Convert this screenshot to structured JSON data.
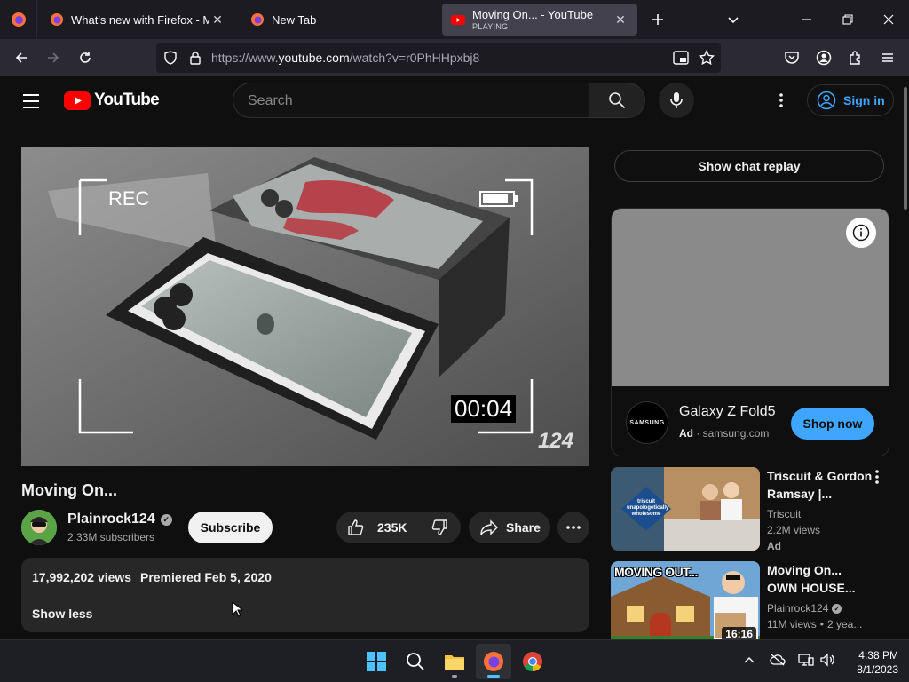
{
  "browser": {
    "tabs": [
      {
        "title": "What's new with Firefox - More",
        "subtitle": "",
        "active": false
      },
      {
        "title": "New Tab",
        "subtitle": "",
        "active": false
      },
      {
        "title": "Moving On... - YouTube",
        "subtitle": "PLAYING",
        "active": true
      }
    ],
    "url_prefix": "https://www.",
    "url_domain": "youtube.com",
    "url_path": "/watch?v=r0PhHHpxbj8"
  },
  "youtube": {
    "logo_text": "YouTube",
    "search_placeholder": "Search",
    "sign_in_label": "Sign in"
  },
  "video": {
    "overlay_rec": "REC",
    "overlay_timecode": "00:04",
    "overlay_watermark": "124",
    "title": "Moving On...",
    "channel": "Plainrock124",
    "subscribers": "2.33M subscribers",
    "subscribe_label": "Subscribe",
    "likes": "235K",
    "share_label": "Share",
    "views": "17,992,202 views",
    "premiered": "Premiered Feb 5, 2020",
    "show_less_label": "Show less"
  },
  "sidebar": {
    "chat_replay_label": "Show chat replay",
    "ad": {
      "brand_logo_text": "SAMSUNG",
      "product": "Galaxy Z Fold5",
      "ad_badge": "Ad",
      "domain": "samsung.com",
      "cta": "Shop now"
    },
    "recommendations": [
      {
        "title": "Triscuit & Gordon Ramsay |...",
        "channel": "Triscuit",
        "stats": "2.2M views",
        "badge": "Ad",
        "thumb_text": "triscuit unapologetically wholesome",
        "duration": ""
      },
      {
        "title": "Moving On... OWN HOUSE...",
        "channel": "Plainrock124",
        "stats": "11M views",
        "age": "2 yea...",
        "thumb_text": "MOVING OUT...",
        "duration": "16:16"
      }
    ]
  },
  "taskbar": {
    "time": "4:38 PM",
    "date": "8/1/2023"
  },
  "colors": {
    "yt_red": "#ff0000",
    "link_blue": "#3ea6ff",
    "bg": "#0f0f0f"
  }
}
